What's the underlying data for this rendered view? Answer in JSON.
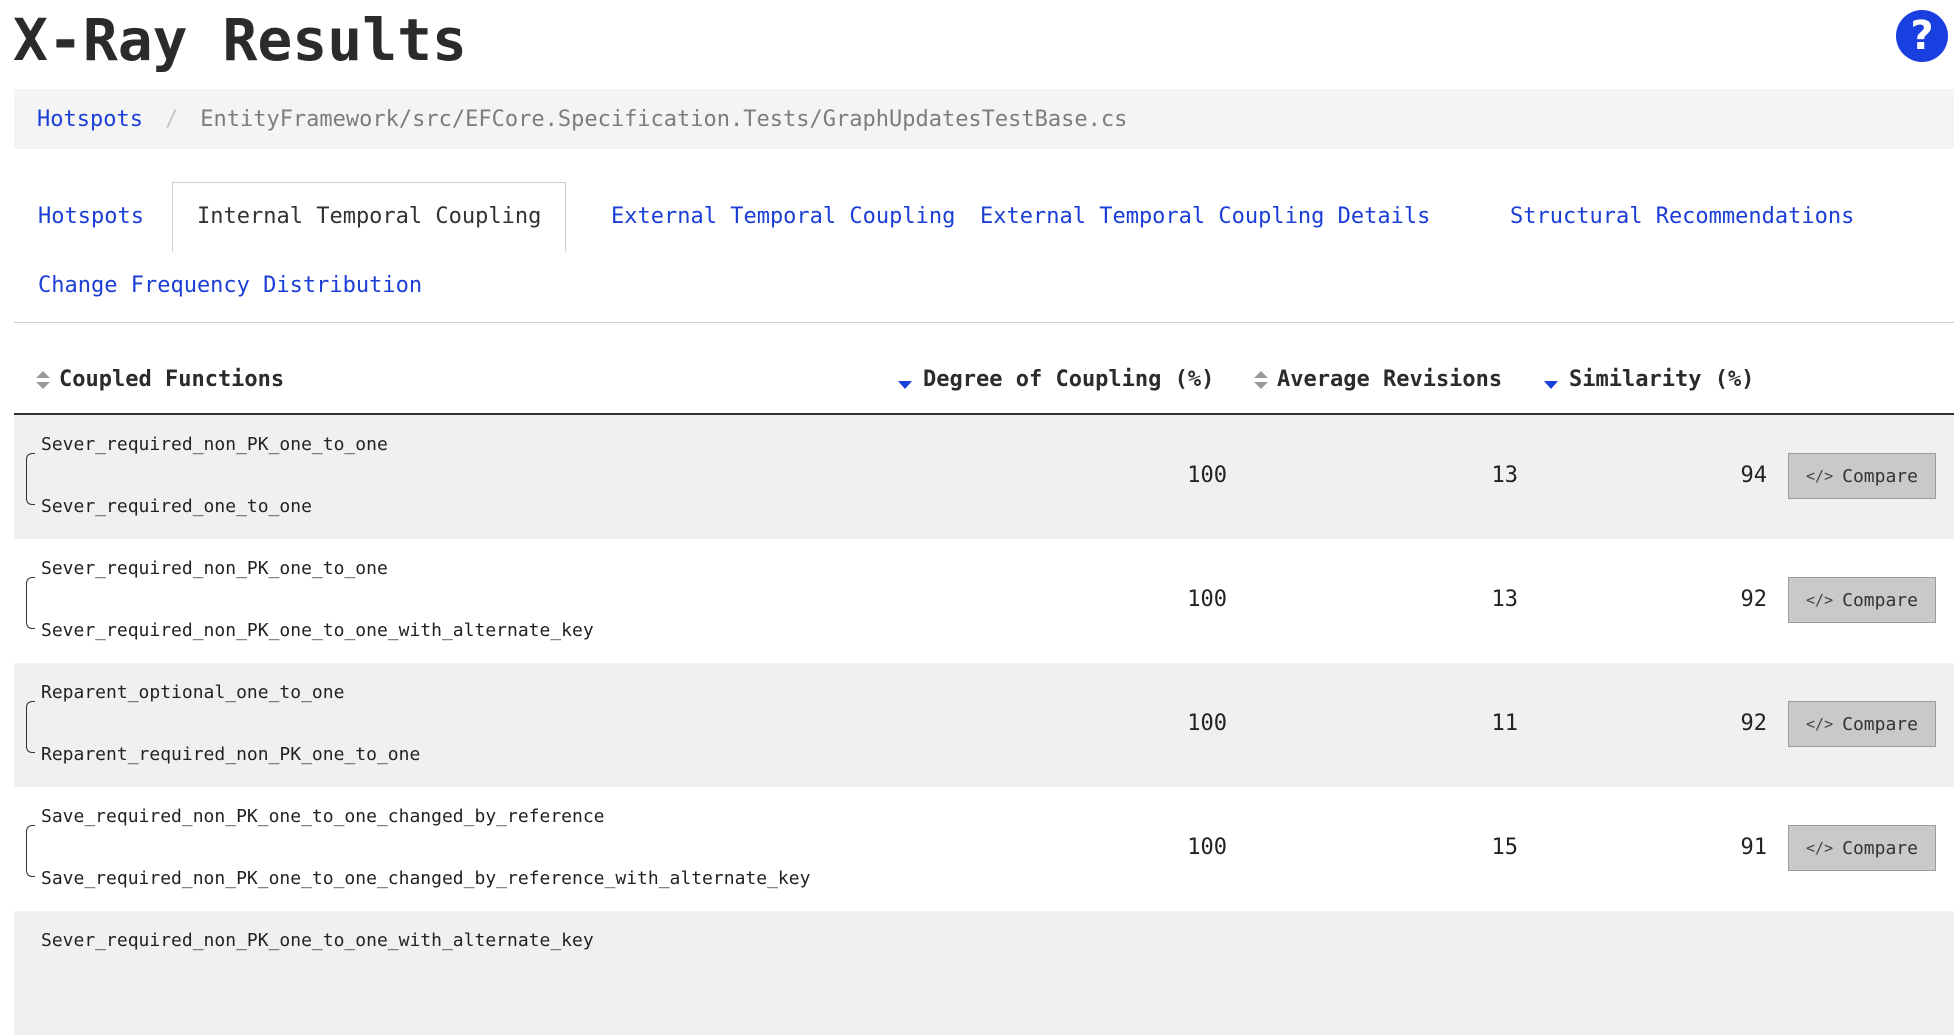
{
  "header": {
    "title": "X-Ray Results",
    "help_icon": "?"
  },
  "breadcrumb": {
    "link": "Hotspots",
    "separator": "/",
    "current": "EntityFramework/src/EFCore.Specification.Tests/GraphUpdatesTestBase.cs"
  },
  "tabs": [
    {
      "label": "Hotspots",
      "active": false
    },
    {
      "label": "Internal Temporal Coupling",
      "active": true
    },
    {
      "label": "External Temporal Coupling",
      "active": false
    },
    {
      "label": "External Temporal Coupling Details",
      "active": false
    },
    {
      "label": "Structural Recommendations",
      "active": false
    },
    {
      "label": "Change Frequency Distribution",
      "active": false
    }
  ],
  "table": {
    "columns": {
      "functions": "Coupled Functions",
      "coupling": "Degree of Coupling (%)",
      "revisions": "Average Revisions",
      "similarity": "Similarity (%)"
    },
    "compare_label": "Compare",
    "compare_icon": "</>",
    "rows": [
      {
        "fn_a": "Sever_required_non_PK_one_to_one",
        "fn_b": "Sever_required_one_to_one",
        "coupling": "100",
        "revisions": "13",
        "similarity": "94"
      },
      {
        "fn_a": "Sever_required_non_PK_one_to_one",
        "fn_b": "Sever_required_non_PK_one_to_one_with_alternate_key",
        "coupling": "100",
        "revisions": "13",
        "similarity": "92"
      },
      {
        "fn_a": "Reparent_optional_one_to_one",
        "fn_b": "Reparent_required_non_PK_one_to_one",
        "coupling": "100",
        "revisions": "11",
        "similarity": "92"
      },
      {
        "fn_a": "Save_required_non_PK_one_to_one_changed_by_reference",
        "fn_b": "Save_required_non_PK_one_to_one_changed_by_reference_with_alternate_key",
        "coupling": "100",
        "revisions": "15",
        "similarity": "91"
      },
      {
        "fn_a": "Sever_required_non_PK_one_to_one_with_alternate_key",
        "fn_b": "",
        "coupling": "",
        "revisions": "",
        "similarity": ""
      }
    ]
  }
}
